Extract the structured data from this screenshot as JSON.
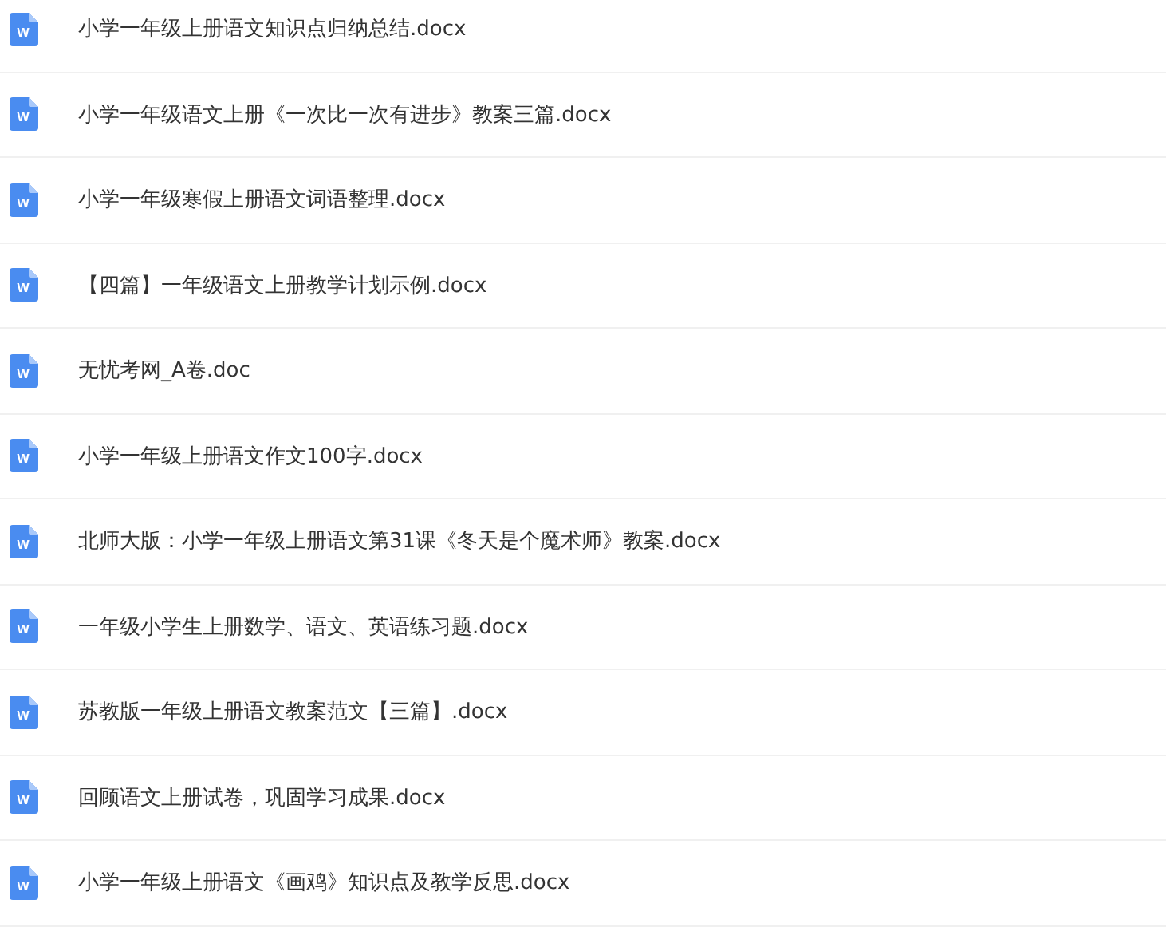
{
  "files": [
    {
      "name": "小学一年级上册语文知识点归纳总结.docx",
      "icon_letter": "W"
    },
    {
      "name": "小学一年级语文上册《一次比一次有进步》教案三篇.docx",
      "icon_letter": "W"
    },
    {
      "name": "小学一年级寒假上册语文词语整理.docx",
      "icon_letter": "W"
    },
    {
      "name": "【四篇】一年级语文上册教学计划示例.docx",
      "icon_letter": "W"
    },
    {
      "name": "无忧考网_A卷.doc",
      "icon_letter": "W"
    },
    {
      "name": "小学一年级上册语文作文100字.docx",
      "icon_letter": "W"
    },
    {
      "name": "北师大版：小学一年级上册语文第31课《冬天是个魔术师》教案.docx",
      "icon_letter": "W"
    },
    {
      "name": "一年级小学生上册数学、语文、英语练习题.docx",
      "icon_letter": "W"
    },
    {
      "name": "苏教版一年级上册语文教案范文【三篇】.docx",
      "icon_letter": "W"
    },
    {
      "name": "回顾语文上册试卷，巩固学习成果.docx",
      "icon_letter": "W"
    },
    {
      "name": "小学一年级上册语文《画鸡》知识点及教学反思.docx",
      "icon_letter": "W"
    }
  ]
}
